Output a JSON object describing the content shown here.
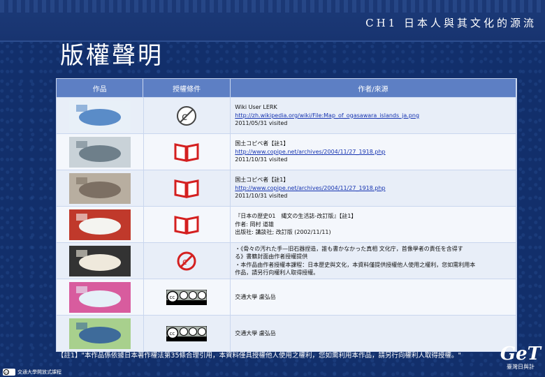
{
  "header": {
    "chapter": "CH1  日本人與其文化的源流"
  },
  "page_title": "版權聲明",
  "table": {
    "columns": [
      "作品",
      "授權條件",
      "作者/來源"
    ],
    "rows": [
      {
        "license_icon": "public-domain-icon",
        "lines": [
          "Wiki User LERK",
          "http://zh.wikipedia.org/wiki/File:Map_of_ogasawara_islands_ja.png",
          "2011/05/31 visited"
        ],
        "link_index": 1
      },
      {
        "license_icon": "copyright-book-icon",
        "lines": [
          "国土コピペ者【註1】",
          "http://www.copipe.net/archives/2004/11/27_1918.php",
          "2011/10/31 visited"
        ],
        "link_index": 1
      },
      {
        "license_icon": "copyright-book-icon",
        "lines": [
          "国土コピペ者【註1】",
          "http://www.copipe.net/archives/2004/11/27_1918.php",
          "2011/10/31 visited"
        ],
        "link_index": 1
      },
      {
        "license_icon": "copyright-book-icon",
        "lines": [
          "『日本の歴史01　縄文の生活誌-改訂版』【註1】",
          "作者: 岡村 道雄",
          "出版社: 講談社; 改訂版 (2002/11/11)"
        ],
        "link_index": -1
      },
      {
        "license_icon": "no-copyright-icon",
        "lines": [
          "・《骨々の汚れた手—旧石器捏造，誰も書かなかった真相 文化庁，首像學者の責任を含得す",
          "る》書籍封面由作者授權提供",
          "・本作品由作者授權本課程：日本歷史與文化，本資料僅提供授權他人使用之權利，您如需利用本",
          "作品，請另行向權利人取得授權。"
        ],
        "link_index": -1
      },
      {
        "license_icon": "cc-by-nc-sa-icon",
        "lines": [
          "交通大學 盧弘岳"
        ],
        "link_index": -1
      },
      {
        "license_icon": "cc-by-nc-sa-icon",
        "lines": [
          "交通大學 盧弘岳"
        ],
        "link_index": -1
      }
    ]
  },
  "footnote": "【註1】\"本作品係依據日本著作權法第35條合理引用，本資料僅具授權他人使用之權利，您如需利用本作品，請另行向權利人取得授權。\"",
  "footer_left": "交通大學開放式課程",
  "logo": {
    "big": "GeT",
    "small": "臺灣日與計"
  }
}
